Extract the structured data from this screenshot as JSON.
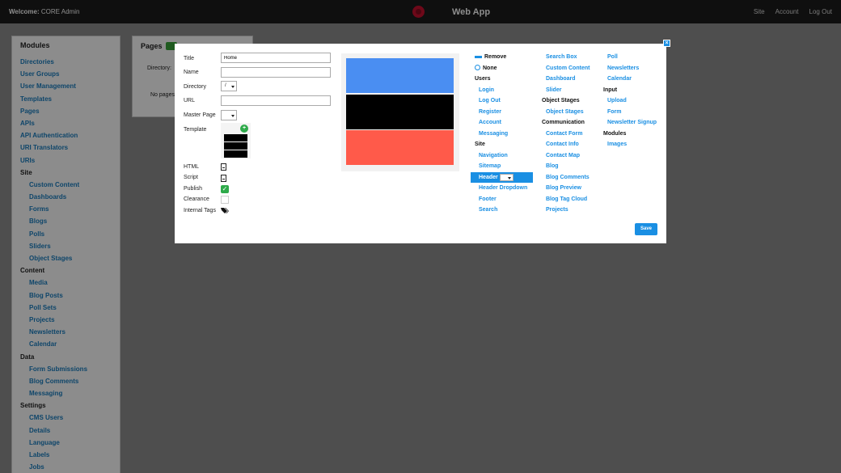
{
  "topbar": {
    "welcome_label": "Welcome:",
    "welcome_user": "CORE Admin",
    "app_title": "Web App",
    "links": [
      "Site",
      "Account",
      "Log Out"
    ]
  },
  "sidebar": {
    "title": "Modules",
    "items": [
      {
        "label": "Directories",
        "kind": "link"
      },
      {
        "label": "User Groups",
        "kind": "link"
      },
      {
        "label": "User Management",
        "kind": "link"
      },
      {
        "label": "Templates",
        "kind": "link"
      },
      {
        "label": "Pages",
        "kind": "link"
      },
      {
        "label": "APIs",
        "kind": "link"
      },
      {
        "label": "API Authentication",
        "kind": "link"
      },
      {
        "label": "URI Translators",
        "kind": "link"
      },
      {
        "label": "URIs",
        "kind": "link"
      },
      {
        "label": "Site",
        "kind": "section"
      },
      {
        "label": "Custom Content",
        "kind": "sub"
      },
      {
        "label": "Dashboards",
        "kind": "sub"
      },
      {
        "label": "Forms",
        "kind": "sub"
      },
      {
        "label": "Blogs",
        "kind": "sub"
      },
      {
        "label": "Polls",
        "kind": "sub"
      },
      {
        "label": "Sliders",
        "kind": "sub"
      },
      {
        "label": "Object Stages",
        "kind": "sub"
      },
      {
        "label": "Content",
        "kind": "section"
      },
      {
        "label": "Media",
        "kind": "sub"
      },
      {
        "label": "Blog Posts",
        "kind": "sub"
      },
      {
        "label": "Poll Sets",
        "kind": "sub"
      },
      {
        "label": "Projects",
        "kind": "sub"
      },
      {
        "label": "Newsletters",
        "kind": "sub"
      },
      {
        "label": "Calendar",
        "kind": "sub"
      },
      {
        "label": "Data",
        "kind": "section"
      },
      {
        "label": "Form Submissions",
        "kind": "sub"
      },
      {
        "label": "Blog Comments",
        "kind": "sub"
      },
      {
        "label": "Messaging",
        "kind": "sub"
      },
      {
        "label": "Settings",
        "kind": "section"
      },
      {
        "label": "CMS Users",
        "kind": "sub"
      },
      {
        "label": "Details",
        "kind": "sub"
      },
      {
        "label": "Language",
        "kind": "sub"
      },
      {
        "label": "Labels",
        "kind": "sub"
      },
      {
        "label": "Jobs",
        "kind": "sub"
      }
    ]
  },
  "pages_panel": {
    "title": "Pages",
    "directory_label": "Directory:",
    "empty_text": "No pages"
  },
  "modal": {
    "close_glyph": "×",
    "fields": {
      "title_label": "Title",
      "title_value": "Home",
      "name_label": "Name",
      "name_value": "",
      "directory_label": "Directory",
      "directory_value": "/",
      "url_label": "URL",
      "url_value": "",
      "master_page_label": "Master Page",
      "master_page_value": "",
      "template_label": "Template",
      "template_add_glyph": "+",
      "html_label": "HTML",
      "script_label": "Script",
      "publish_label": "Publish",
      "publish_checked": true,
      "clearance_label": "Clearance",
      "clearance_checked": false,
      "internal_tags_label": "Internal Tags"
    },
    "preview_colors": [
      "#4a8ef2",
      "#000000",
      "#ff5a4a"
    ],
    "widgets": {
      "col1": [
        {
          "label": "Remove",
          "kind": "action",
          "icon": "remove-bar-icon"
        },
        {
          "label": "None",
          "kind": "action",
          "icon": "link-icon"
        },
        {
          "label": "Users",
          "kind": "group"
        },
        {
          "label": "Login",
          "kind": "item"
        },
        {
          "label": "Log Out",
          "kind": "item"
        },
        {
          "label": "Register",
          "kind": "item"
        },
        {
          "label": "Account",
          "kind": "item"
        },
        {
          "label": "Messaging",
          "kind": "item"
        },
        {
          "label": "Site",
          "kind": "group"
        },
        {
          "label": "Navigation",
          "kind": "item"
        },
        {
          "label": "Sitemap",
          "kind": "item"
        },
        {
          "label": "Header",
          "kind": "selected"
        },
        {
          "label": "Header Dropdown",
          "kind": "item"
        },
        {
          "label": "Footer",
          "kind": "item"
        },
        {
          "label": "Search",
          "kind": "item"
        }
      ],
      "col2": [
        {
          "label": "Search Box",
          "kind": "item"
        },
        {
          "label": "Custom Content",
          "kind": "item"
        },
        {
          "label": "Dashboard",
          "kind": "item"
        },
        {
          "label": "Slider",
          "kind": "item"
        },
        {
          "label": "Object Stages",
          "kind": "group"
        },
        {
          "label": "Object Stages",
          "kind": "item"
        },
        {
          "label": "Communication",
          "kind": "group"
        },
        {
          "label": "Contact Form",
          "kind": "item"
        },
        {
          "label": "Contact Info",
          "kind": "item"
        },
        {
          "label": "Contact Map",
          "kind": "item"
        },
        {
          "label": "Blog",
          "kind": "item"
        },
        {
          "label": "Blog Comments",
          "kind": "item"
        },
        {
          "label": "Blog Preview",
          "kind": "item"
        },
        {
          "label": "Blog Tag Cloud",
          "kind": "item"
        },
        {
          "label": "Projects",
          "kind": "item"
        }
      ],
      "col3": [
        {
          "label": "Poll",
          "kind": "item"
        },
        {
          "label": "Newsletters",
          "kind": "item"
        },
        {
          "label": "Calendar",
          "kind": "item"
        },
        {
          "label": "Input",
          "kind": "group"
        },
        {
          "label": "Upload",
          "kind": "item"
        },
        {
          "label": "Form",
          "kind": "item"
        },
        {
          "label": "Newsletter Signup",
          "kind": "item"
        },
        {
          "label": "Modules",
          "kind": "group"
        },
        {
          "label": "Images",
          "kind": "item"
        }
      ]
    },
    "save_label": "Save"
  }
}
